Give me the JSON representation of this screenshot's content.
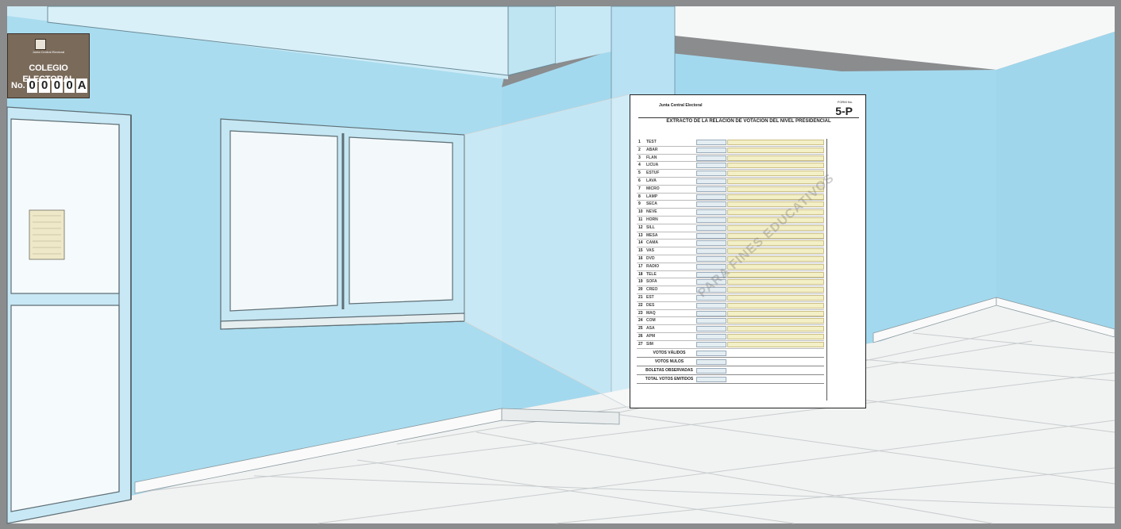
{
  "sign": {
    "institution": "Junta Central Electoral",
    "title": "COLEGIO ELECTORAL",
    "number_label": "No.",
    "digits": [
      "0",
      "0",
      "0",
      "0",
      "A"
    ]
  },
  "form": {
    "institution": "Junta Central Electoral",
    "code_label": "FORM No.",
    "code": "5-P",
    "title": "EXTRACTO DE LA RELACIÓN DE VOTACIÓN DEL NIVEL PRESIDENCIAL",
    "rows": [
      {
        "n": "1",
        "party": "TEST"
      },
      {
        "n": "2",
        "party": "ABAR"
      },
      {
        "n": "3",
        "party": "FLAN"
      },
      {
        "n": "4",
        "party": "LICUA"
      },
      {
        "n": "5",
        "party": "ESTUF"
      },
      {
        "n": "6",
        "party": "LAVA"
      },
      {
        "n": "7",
        "party": "MICRO"
      },
      {
        "n": "8",
        "party": "LAMP"
      },
      {
        "n": "9",
        "party": "SECA"
      },
      {
        "n": "10",
        "party": "NEVE"
      },
      {
        "n": "11",
        "party": "HORN"
      },
      {
        "n": "12",
        "party": "SILL"
      },
      {
        "n": "13",
        "party": "MESA"
      },
      {
        "n": "14",
        "party": "CAMA"
      },
      {
        "n": "15",
        "party": "VAS"
      },
      {
        "n": "16",
        "party": "DVD"
      },
      {
        "n": "17",
        "party": "RADIO"
      },
      {
        "n": "18",
        "party": "TELE"
      },
      {
        "n": "19",
        "party": "SOFA"
      },
      {
        "n": "20",
        "party": "CREO"
      },
      {
        "n": "21",
        "party": "EST"
      },
      {
        "n": "22",
        "party": "DES"
      },
      {
        "n": "23",
        "party": "MAQ"
      },
      {
        "n": "24",
        "party": "COM"
      },
      {
        "n": "25",
        "party": "ASA"
      },
      {
        "n": "26",
        "party": "APM"
      },
      {
        "n": "27",
        "party": "SIM"
      }
    ],
    "totals": [
      "VOTOS VÁLIDOS",
      "VOTOS NULOS",
      "BOLETAS OBSERVADAS",
      "TOTAL VOTOS EMITIDOS"
    ],
    "watermark": "PARA FINES EDUCATIVOS"
  },
  "colors": {
    "wall": "#a8dcef",
    "wall_light": "#d4eef8",
    "floor": "#f2f4f4",
    "frame": "#8a8c8e"
  }
}
